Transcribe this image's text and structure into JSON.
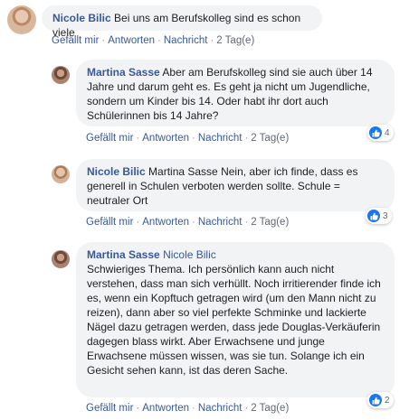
{
  "comments": [
    {
      "author": "Nicole Bilic",
      "text": "Bei uns am Berufskolleg sind es schon viele",
      "actions": {
        "like": "Gefällt mir",
        "reply": "Antworten",
        "report": "Nachricht",
        "time": "2 Tag(e)"
      }
    },
    {
      "author": "Martina Sasse",
      "text": "Aber am Berufskolleg sind sie auch über 14 Jahre und darum geht es. Es geht ja nicht um Jugendliche, sondern um Kinder bis 14. Oder habt ihr dort auch Schülerinnen bis 14 Jahre?",
      "actions": {
        "like": "Gefällt mir",
        "reply": "Antworten",
        "report": "Nachricht",
        "time": "2 Tag(e)"
      },
      "reactions": "4"
    },
    {
      "author": "Nicole Bilic",
      "text": "Martina Sasse Nein, aber ich finde, dass es generell in Schulen verboten werden sollte. Schule = neutraler Ort",
      "actions": {
        "like": "Gefällt mir",
        "reply": "Antworten",
        "report": "Nachricht",
        "time": "2 Tag(e)"
      },
      "reactions": "3"
    },
    {
      "author": "Martina Sasse",
      "mention": "Nicole Bilic",
      "text": "Schwieriges Thema. Ich persönlich kann auch nicht verstehen, dass man sich verhüllt. Noch irritierender finde ich es, wenn ein Kopftuch getragen wird (um den Mann nicht zu reizen), dann aber so viel perfekte Schminke und lackierte Nägel dazu getragen werden, dass jede Douglas-Verkäuferin dagegen blass wirkt. Aber Erwachsene und junge Erwachsene müssen wissen, was sie tun. Solange ich ein Gesicht sehen kann, ist das deren Sache.",
      "actions": {
        "like": "Gefällt mir",
        "reply": "Antworten",
        "report": "Nachricht",
        "time": "2 Tag(e)"
      },
      "reactions": "2"
    }
  ],
  "colors": {
    "link": "#385898",
    "bubble": "#f2f3f5",
    "like": "#1877f2"
  },
  "icons": {
    "reaction": "thumbs-up-icon"
  }
}
